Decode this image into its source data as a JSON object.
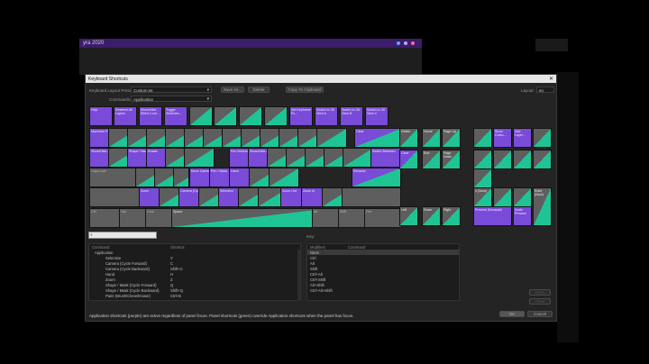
{
  "background": {
    "app_title": "yra 2020"
  },
  "dialog": {
    "title": "Keyboard Shortcuts",
    "close_glyph": "✕",
    "layout_preset_label": "Keyboard Layout Preset:",
    "layout_preset_value": "Custom.txt",
    "save_as_label": "Save As...",
    "delete_label": "Delete",
    "copy_label": "Copy To Clipboard",
    "layout_label": "Layout:",
    "layout_value": "en",
    "commands_label": "Commands:",
    "commands_value": "Application",
    "key_label": "Key:",
    "footer_text": "Application shortcuts (purple) are active regardless of panel focus. Panel shortcuts (green) override Application shortcuts when the panel has focus.",
    "ok_label": "OK",
    "cancel_label": "Cancel",
    "undo_label": "Undo",
    "clear_label": "Clear"
  },
  "keyboard": {
    "keys": [
      "Help",
      "Deselect All Layers",
      "Show/Hide Effect Cont...",
      "Toggle Switches...",
      "",
      "",
      "",
      "",
      "Set Keyframe Ev...",
      "Switch to 3D View A",
      "Switch to 3D View B",
      "Switch to 3D View C",
      "Maximize Panel",
      "",
      "",
      "",
      "",
      "",
      "",
      "",
      "",
      "",
      "",
      "",
      "Clear",
      "",
      "Show/Hide Composition Mini...",
      "",
      "Shape / Mask (C...",
      "Rotate",
      "",
      "",
      "Pen Behind...",
      "Show/Hide As Pr...",
      "",
      "",
      "",
      "",
      "",
      "Switch Between",
      "Caps Lock",
      "",
      "",
      "",
      "",
      "",
      "Move Camera",
      "Pen / Mask...",
      "Hand",
      "",
      "",
      "Rename",
      "",
      "Zoom",
      "",
      "Camera (Cycle...",
      "",
      "Selection",
      "",
      "",
      "Zoom Out",
      "Zoom In",
      "",
      "",
      "Ctrl",
      "Opt",
      "Cmd",
      "Space",
      "Alt",
      "Shift",
      "Ctrl",
      "Del"
    ],
    "nav_keys": [
      "Home",
      "Page Up",
      "Delete",
      "End",
      "Page Down",
      "Left",
      "Down",
      "Right",
      "Clear",
      "Delete"
    ],
    "numpad_keys": [
      "",
      "",
      "Show Curso...",
      "Add Layer...",
      "",
      "",
      "",
      "",
      "",
      "",
      "4 (Num)",
      "",
      "",
      "1 (Num)",
      "Preview (Numpad)",
      "Audio Preview",
      "Enter (Num)"
    ]
  },
  "commands": {
    "col_command": "Command",
    "col_shortcut": "Shortcut",
    "rows": [
      {
        "name": "Application",
        "shortcut": ""
      },
      {
        "name": "Selection",
        "shortcut": "V"
      },
      {
        "name": "Camera (Cycle Forward)",
        "shortcut": "C"
      },
      {
        "name": "Camera (Cycle Backward)",
        "shortcut": "Shift+C"
      },
      {
        "name": "Hand",
        "shortcut": "H"
      },
      {
        "name": "Zoom",
        "shortcut": "Z"
      },
      {
        "name": "Shape / Mask (Cycle Forward)",
        "shortcut": "Q"
      },
      {
        "name": "Shape / Mask (Cycle Backward)",
        "shortcut": "Shift+Q"
      },
      {
        "name": "Paint (Brush/Clone/Eraser)",
        "shortcut": "Ctrl+B"
      }
    ]
  },
  "modifiers": {
    "col_modifiers": "Modifiers",
    "col_command": "Command",
    "rows": [
      "None",
      "Ctrl",
      "Alt",
      "Shift",
      "Ctrl+Alt",
      "Ctrl+Shift",
      "Alt+Shift",
      "Ctrl+Alt+Shift"
    ]
  },
  "colors": {
    "app_shortcut": "#7a4ad8",
    "panel_shortcut": "#1fc495",
    "unassigned": "#5e5e5e"
  }
}
